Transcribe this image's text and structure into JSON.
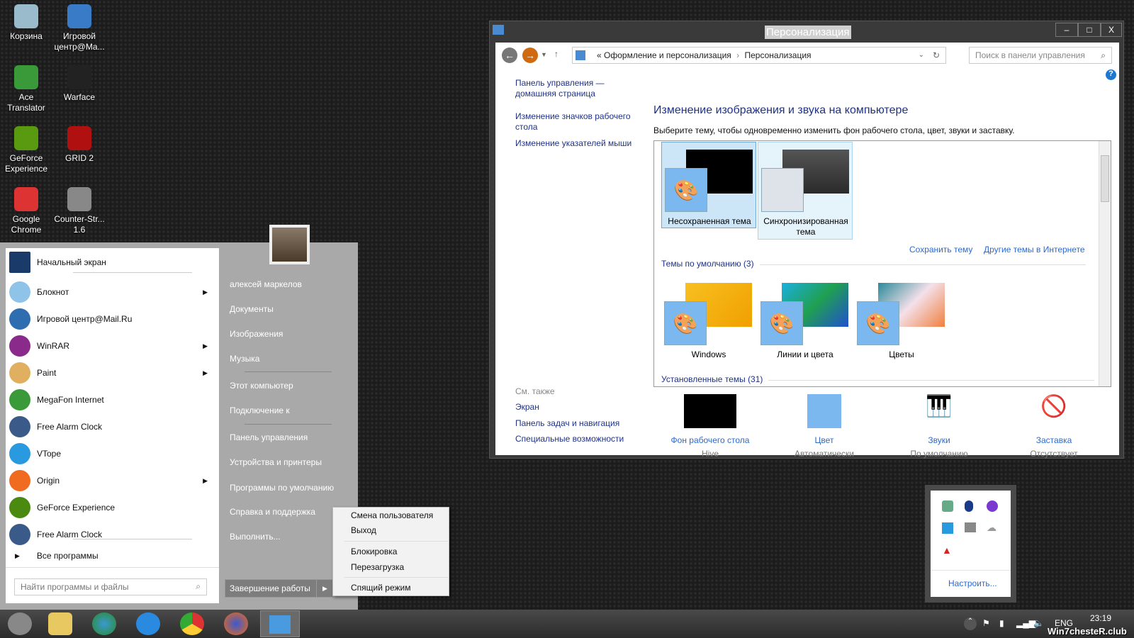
{
  "desktop": {
    "icons": [
      {
        "label": "Корзина",
        "icon": "recycle-bin-icon",
        "color": "#9bc"
      },
      {
        "label": "Игровой центр@Ma...",
        "icon": "game-center-icon",
        "color": "#3a7bc8"
      },
      {
        "label": "Ace Translator",
        "icon": "globe-icon",
        "color": "#3a9a3a"
      },
      {
        "label": "Warface",
        "icon": "warface-icon",
        "color": "#222"
      },
      {
        "label": "GeForce Experience",
        "icon": "nvidia-icon",
        "color": "#5a9a10"
      },
      {
        "label": "GRID 2",
        "icon": "grid2-icon",
        "color": "#b01010"
      },
      {
        "label": "Google Chrome",
        "icon": "chrome-icon",
        "color": "#d33"
      },
      {
        "label": "Counter-Str... 1.6",
        "icon": "counter-strike-icon",
        "color": "#888"
      }
    ]
  },
  "window": {
    "title": "Персонализация",
    "minimize": "–",
    "maximize": "□",
    "close": "X",
    "breadcrumb": [
      "«",
      "Оформление и персонализация",
      "›",
      "Персонализация"
    ],
    "search_placeholder": "Поиск в панели управления",
    "sidebar": [
      "Панель управления — домашняя страница",
      "Изменение значков рабочего стола",
      "Изменение указателей мыши"
    ],
    "heading": "Изменение изображения и звука на компьютере",
    "subtitle": "Выберите тему, чтобы одновременно изменить фон рабочего стола, цвет, звуки и заставку.",
    "my_themes": [
      {
        "label": "Несохраненная тема",
        "selected": true
      },
      {
        "label": "Синхронизированная тема",
        "selected": false
      }
    ],
    "save_theme": "Сохранить тему",
    "more_themes": "Другие темы в Интернете",
    "default_section": "Темы по умолчанию (3)",
    "default_themes": [
      "Windows",
      "Линии и цвета",
      "Цветы"
    ],
    "installed_section": "Установленные темы (31)",
    "see_also": {
      "title": "См. также",
      "links": [
        "Экран",
        "Панель задач и навигация",
        "Специальные возможности"
      ]
    },
    "bottom": [
      {
        "label": "Фон рабочего стола",
        "value": "Hive"
      },
      {
        "label": "Цвет",
        "value": "Автоматически"
      },
      {
        "label": "Звуки",
        "value": "По умолчанию"
      },
      {
        "label": "Заставка",
        "value": "Отсутствует"
      }
    ]
  },
  "start_menu": {
    "programs": [
      {
        "label": "Начальный экран",
        "arrow": false,
        "color": "#1a3a6a"
      },
      {
        "label": "Блокнот",
        "arrow": true,
        "color": "#8fc3e8"
      },
      {
        "label": "Игровой центр@Mail.Ru",
        "arrow": false,
        "color": "#2d6db0"
      },
      {
        "label": "WinRAR",
        "arrow": true,
        "color": "#8a2a8a"
      },
      {
        "label": "Paint",
        "arrow": true,
        "color": "#e0b060"
      },
      {
        "label": "MegaFon Internet",
        "arrow": false,
        "color": "#3a9a3a"
      },
      {
        "label": "Free Alarm Clock",
        "arrow": false,
        "color": "#3a5a8a"
      },
      {
        "label": "VTope",
        "arrow": false,
        "color": "#2a9ae0"
      },
      {
        "label": "Origin",
        "arrow": true,
        "color": "#f06a20"
      },
      {
        "label": "GeForce Experience",
        "arrow": false,
        "color": "#4a8a10"
      },
      {
        "label": "Free Alarm Clock",
        "arrow": false,
        "color": "#3a5a8a"
      }
    ],
    "all_programs": "Все программы",
    "search_placeholder": "Найти программы и файлы",
    "places": [
      "алексей маркелов",
      "Документы",
      "Изображения",
      "Музыка",
      "Этот компьютер",
      "Подключение к",
      "Панель управления",
      "Устройства и принтеры",
      "Программы по умолчанию",
      "Справка и поддержка",
      "Выполнить..."
    ],
    "shutdown": "Завершение работы",
    "power_menu": [
      "Смена пользователя",
      "Выход",
      "Блокировка",
      "Перезагрузка",
      "Спящий режим"
    ]
  },
  "tray_popup": {
    "customize": "Настроить..."
  },
  "taskbar": {
    "language": "ENG",
    "time": "23:19",
    "watermark": "Win7chesteR.club"
  }
}
